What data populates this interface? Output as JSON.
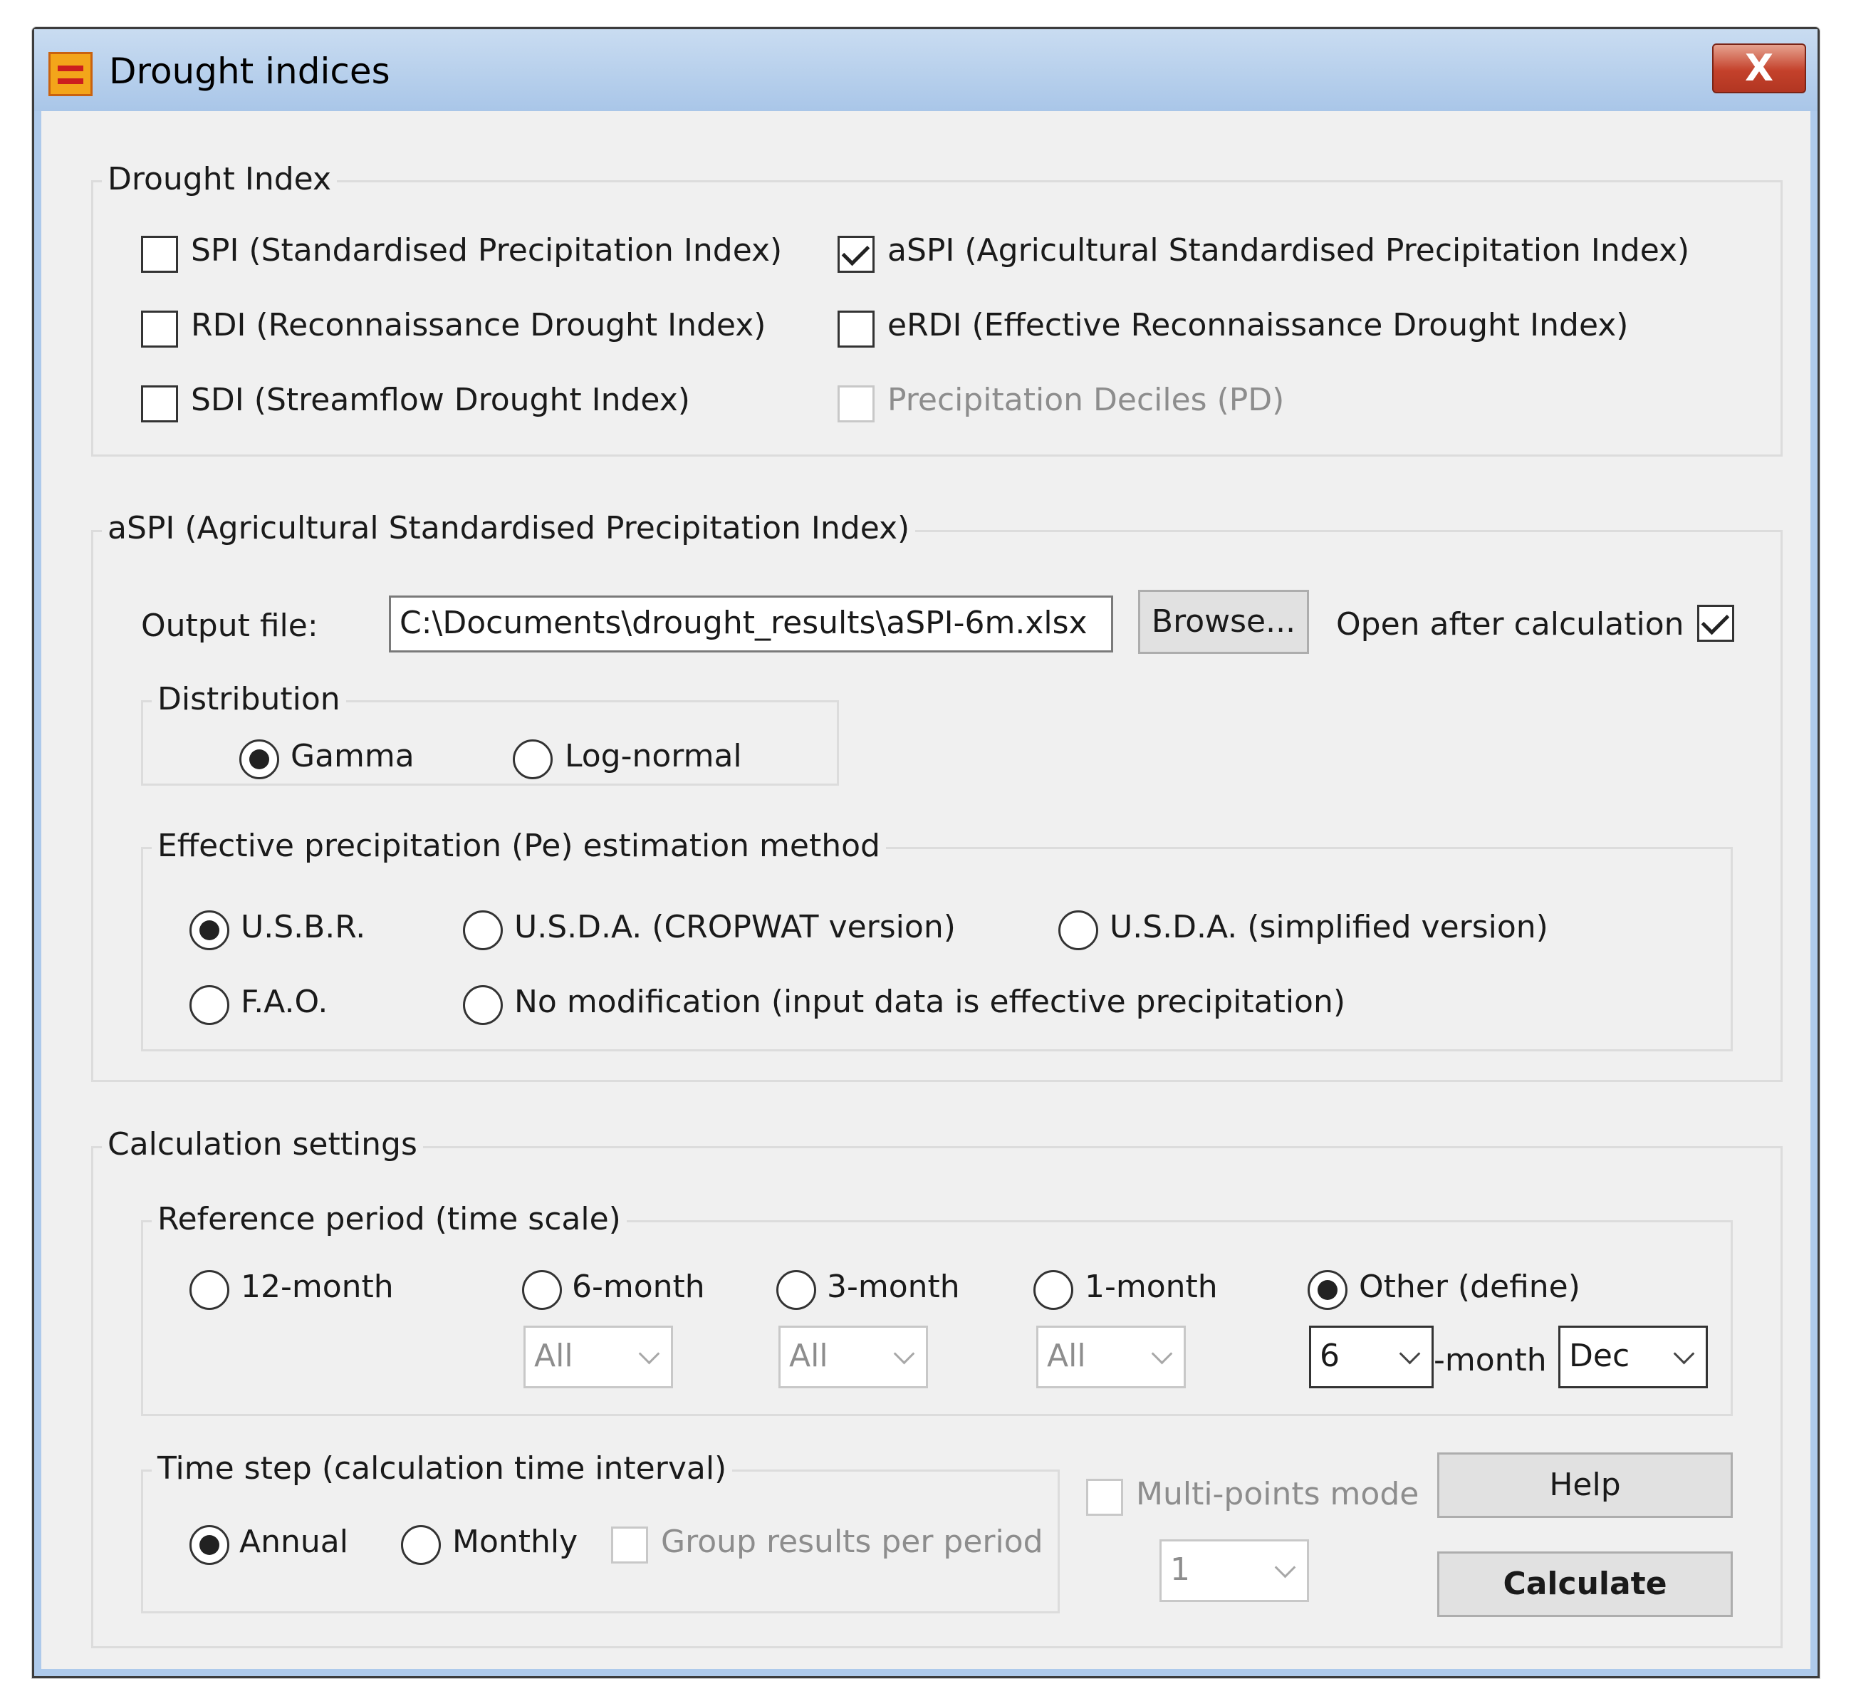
{
  "window": {
    "title": "Drought indices",
    "close_label": "X"
  },
  "drought_index": {
    "group_label": "Drought Index",
    "options": [
      {
        "label": "SPI (Standardised Precipitation Index)",
        "checked": false
      },
      {
        "label": "RDI (Reconnaissance Drought Index)",
        "checked": false
      },
      {
        "label": "SDI (Streamflow Drought Index)",
        "checked": false
      },
      {
        "label": "aSPI (Agricultural Standardised Precipitation Index)",
        "checked": true
      },
      {
        "label": "eRDI (Effective Reconnaissance Drought Index)",
        "checked": false
      },
      {
        "label": "Precipitation Deciles (PD)",
        "checked": false,
        "disabled": true
      }
    ]
  },
  "aspi": {
    "group_label": "aSPI (Agricultural Standardised Precipitation Index)",
    "output_file_label": "Output file:",
    "output_file_value": "C:\\Documents\\drought_results\\aSPI-6m.xlsx",
    "browse_label": "Browse...",
    "open_after_label": "Open after calculation",
    "open_after_checked": true,
    "distribution": {
      "group_label": "Distribution",
      "gamma_label": "Gamma",
      "lognormal_label": "Log-normal",
      "selected": "Gamma"
    },
    "pe_method": {
      "group_label": "Effective precipitation (Pe) estimation method",
      "usbr_label": "U.S.B.R.",
      "usda_cropwat_label": "U.S.D.A. (CROPWAT  version)",
      "usda_simplified_label": "U.S.D.A. (simplified version)",
      "fao_label": "F.A.O.",
      "no_mod_label": "No modification (input data is effective precipitation)",
      "selected": "U.S.B.R."
    }
  },
  "calc": {
    "group_label": "Calculation settings",
    "reference": {
      "group_label": "Reference period (time scale)",
      "m12_label": "12-month",
      "m6_label": "6-month",
      "m3_label": "3-month",
      "m1_label": "1-month",
      "other_label": "Other (define)",
      "m6_value": "All",
      "m3_value": "All",
      "m1_value": "All",
      "other_value": "6",
      "month_suffix": "-month",
      "end_month": "Dec",
      "selected": "Other (define)"
    },
    "timestep": {
      "group_label": "Time step (calculation time interval)",
      "annual_label": "Annual",
      "monthly_label": "Monthly",
      "group_results_label": "Group results per period",
      "selected": "Annual"
    },
    "multipoints_label": "Multi-points mode",
    "multipoints_value": "1",
    "help_label": "Help",
    "calculate_label": "Calculate"
  }
}
